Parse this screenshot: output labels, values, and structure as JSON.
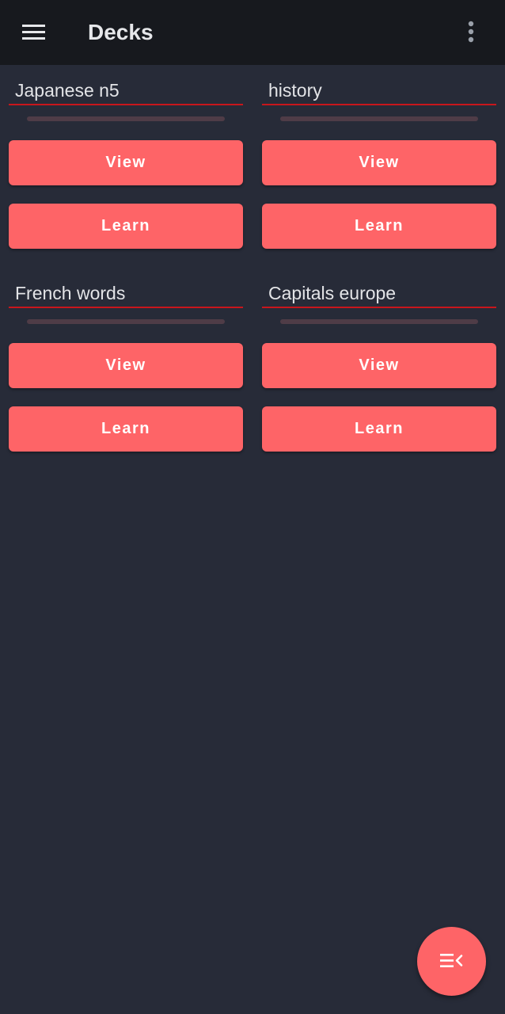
{
  "app_bar": {
    "title": "Decks",
    "menu_icon": "hamburger-menu-icon",
    "overflow_icon": "more-vert-icon"
  },
  "decks": [
    {
      "name": "Japanese n5",
      "progress": 0,
      "view_label": "View",
      "learn_label": "Learn"
    },
    {
      "name": "history",
      "progress": 0,
      "view_label": "View",
      "learn_label": "Learn"
    },
    {
      "name": "French words",
      "progress": 0,
      "view_label": "View",
      "learn_label": "Learn"
    },
    {
      "name": "Capitals europe",
      "progress": 0,
      "view_label": "View",
      "learn_label": "Learn"
    }
  ],
  "fab": {
    "icon": "playlist-collapse-icon"
  },
  "colors": {
    "background": "#272b38",
    "app_bar": "#17191e",
    "accent": "#fe6467",
    "underline": "#c8161c",
    "progress_track": "#4f3c47"
  }
}
